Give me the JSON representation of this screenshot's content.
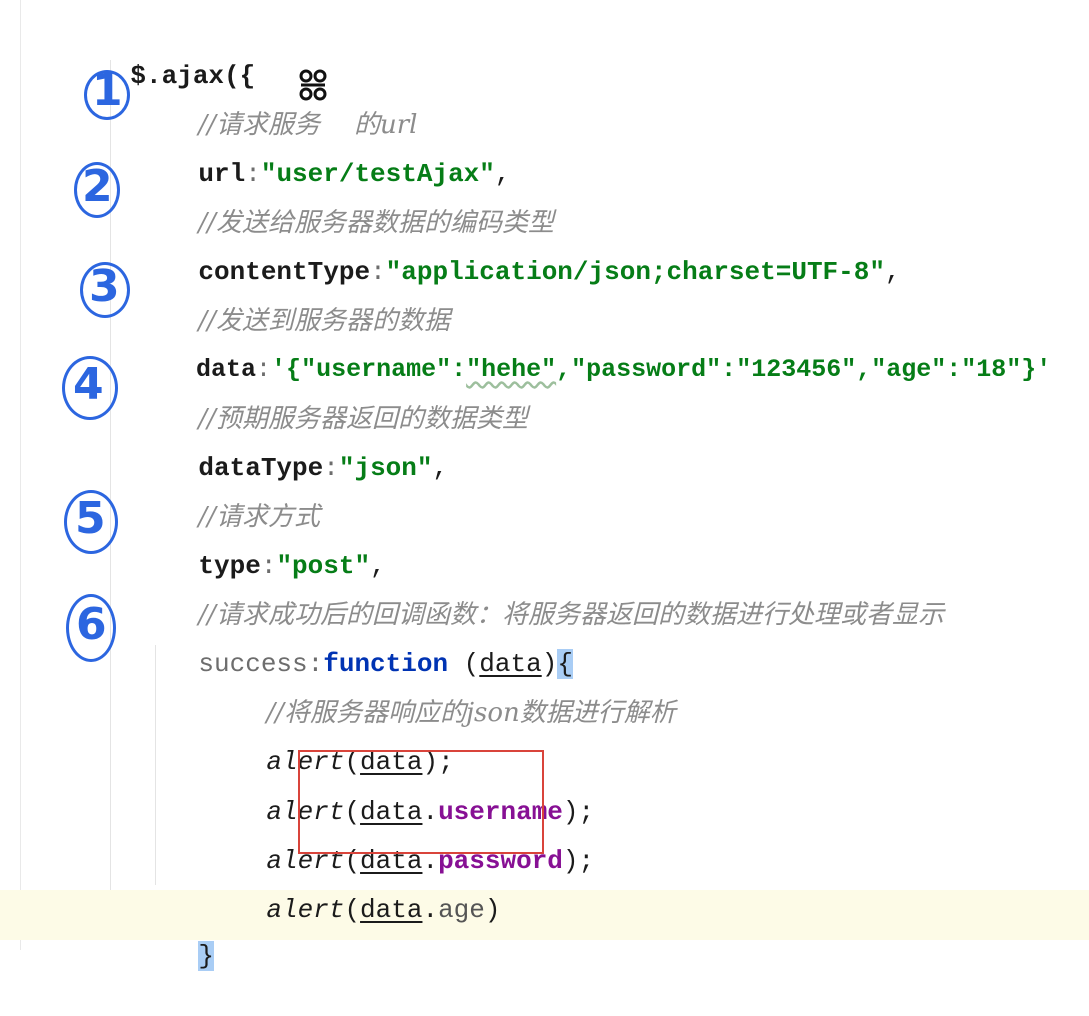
{
  "code": {
    "l1": "$.ajax({",
    "c1": "//请求服务",
    "c1b": "的url",
    "url_key": "url",
    "url_val": "\"user/testAjax\"",
    "c2": "//发送给服务器数据的编码类型",
    "ct_key": "contentType",
    "ct_val": "\"application/json;charset=UTF-8\"",
    "c3": "//发送到服务器的数据",
    "data_key": "data",
    "data_q1": "'{",
    "data_k1": "\"username\"",
    "data_v1": "\"hehe\"",
    "data_k2": "\"password\"",
    "data_v2": "\"123456\"",
    "data_k3": "\"age\"",
    "data_v3": "\"18\"",
    "data_end": "}'",
    "c4": "//预期服务器返回的数据类型",
    "dt_key": "dataType",
    "dt_val": "\"json\"",
    "c5": "//请求方式",
    "type_key": "type",
    "type_val": "\"post\"",
    "c6": "//请求成功后的回调函数：将服务器返回的数据进行处理或者显示",
    "succ_key": "success",
    "succ_kw": "function",
    "succ_param": "data",
    "c7": "//将服务器响应的json数据进行解析",
    "alert": "alert",
    "arg_data": "data",
    "prop_username": "username",
    "prop_password": "password",
    "prop_age": "age",
    "close": "}"
  },
  "annotations": [
    "1",
    "2",
    "3",
    "4",
    "5",
    "6"
  ],
  "colors": {
    "comment": "#8c8c8c",
    "string": "#067d17",
    "keyword": "#0033b3",
    "property": "#871094",
    "annotation": "#2c66e0",
    "highlight_box": "#d9443b",
    "brace_match": "#a9cdf5"
  }
}
